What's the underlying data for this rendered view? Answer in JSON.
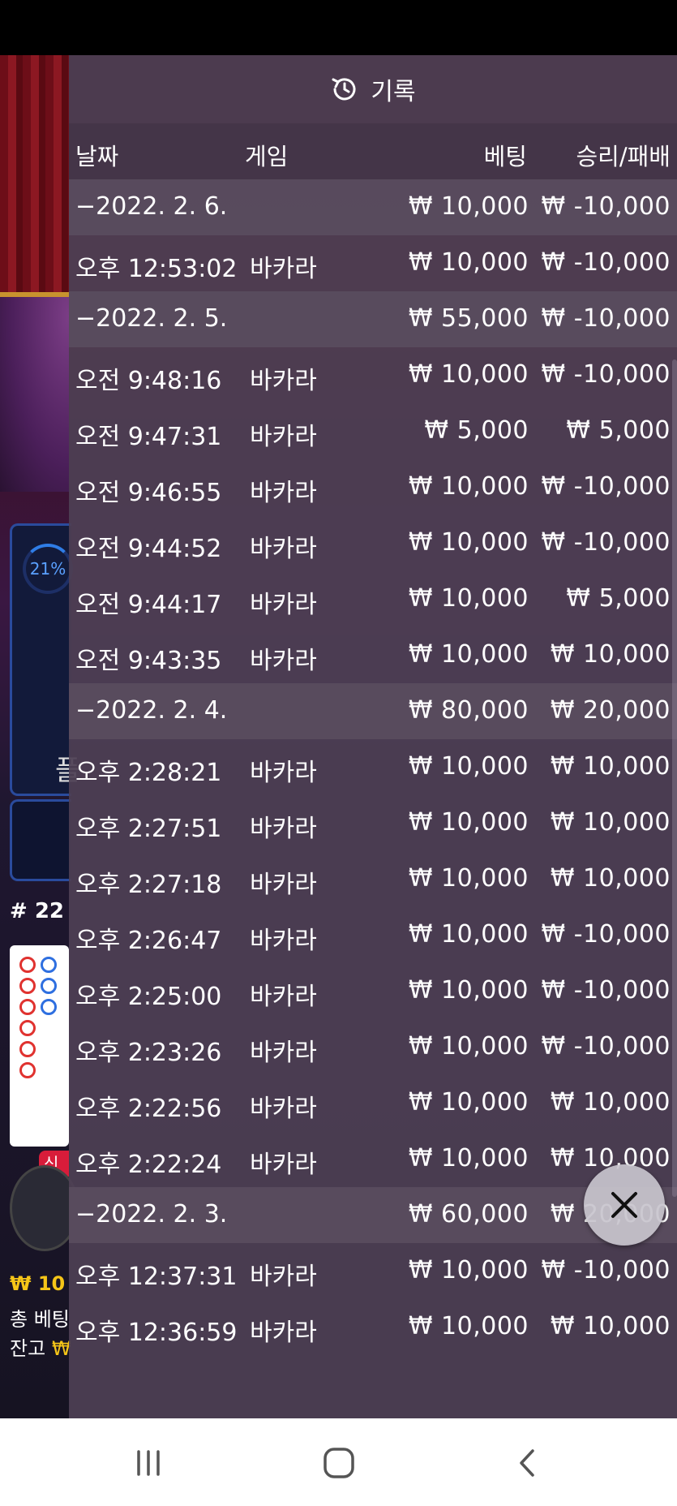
{
  "background": {
    "progress_percent": "21%",
    "side_label": "플",
    "round_number": "# 22",
    "new_badge": "신",
    "balance_line": "₩ 10",
    "total_bet_label": "총 베팅",
    "balance_label": "잔고",
    "balance_value": "₩"
  },
  "panel": {
    "title": "기록",
    "icon": "history-icon",
    "columns": {
      "date": "날짜",
      "game": "게임",
      "bet": "베팅",
      "win_loss": "승리/패배"
    },
    "rows": [
      {
        "type": "group",
        "date": "−2022. 2. 6.",
        "game": "",
        "bet": "₩ 10,000",
        "win": "₩ -10,000"
      },
      {
        "type": "item",
        "date": "오후 12:53:02",
        "game": "바카라",
        "bet": "₩ 10,000",
        "win": "₩ -10,000"
      },
      {
        "type": "group",
        "date": "−2022. 2. 5.",
        "game": "",
        "bet": "₩ 55,000",
        "win": "₩ -10,000"
      },
      {
        "type": "item",
        "date": "오전 9:48:16",
        "game": "바카라",
        "bet": "₩ 10,000",
        "win": "₩ -10,000"
      },
      {
        "type": "item",
        "date": "오전 9:47:31",
        "game": "바카라",
        "bet": "₩ 5,000",
        "win": "₩ 5,000"
      },
      {
        "type": "item",
        "date": "오전 9:46:55",
        "game": "바카라",
        "bet": "₩ 10,000",
        "win": "₩ -10,000"
      },
      {
        "type": "item",
        "date": "오전 9:44:52",
        "game": "바카라",
        "bet": "₩ 10,000",
        "win": "₩ -10,000"
      },
      {
        "type": "item",
        "date": "오전 9:44:17",
        "game": "바카라",
        "bet": "₩ 10,000",
        "win": "₩ 5,000"
      },
      {
        "type": "item",
        "date": "오전 9:43:35",
        "game": "바카라",
        "bet": "₩ 10,000",
        "win": "₩ 10,000"
      },
      {
        "type": "group",
        "date": "−2022. 2. 4.",
        "game": "",
        "bet": "₩ 80,000",
        "win": "₩ 20,000"
      },
      {
        "type": "item",
        "date": "오후 2:28:21",
        "game": "바카라",
        "bet": "₩ 10,000",
        "win": "₩ 10,000"
      },
      {
        "type": "item",
        "date": "오후 2:27:51",
        "game": "바카라",
        "bet": "₩ 10,000",
        "win": "₩ 10,000"
      },
      {
        "type": "item",
        "date": "오후 2:27:18",
        "game": "바카라",
        "bet": "₩ 10,000",
        "win": "₩ 10,000"
      },
      {
        "type": "item",
        "date": "오후 2:26:47",
        "game": "바카라",
        "bet": "₩ 10,000",
        "win": "₩ -10,000"
      },
      {
        "type": "item",
        "date": "오후 2:25:00",
        "game": "바카라",
        "bet": "₩ 10,000",
        "win": "₩ -10,000"
      },
      {
        "type": "item",
        "date": "오후 2:23:26",
        "game": "바카라",
        "bet": "₩ 10,000",
        "win": "₩ -10,000"
      },
      {
        "type": "item",
        "date": "오후 2:22:56",
        "game": "바카라",
        "bet": "₩ 10,000",
        "win": "₩ 10,000"
      },
      {
        "type": "item",
        "date": "오후 2:22:24",
        "game": "바카라",
        "bet": "₩ 10,000",
        "win": "₩ 10,000"
      },
      {
        "type": "group",
        "date": "−2022. 2. 3.",
        "game": "",
        "bet": "₩ 60,000",
        "win": "₩ 20,000"
      },
      {
        "type": "item",
        "date": "오후 12:37:31",
        "game": "바카라",
        "bet": "₩ 10,000",
        "win": "₩ -10,000"
      },
      {
        "type": "item",
        "date": "오후 12:36:59",
        "game": "바카라",
        "bet": "₩ 10,000",
        "win": "₩ 10,000"
      }
    ]
  },
  "close_icon": "close-icon",
  "navbar": {
    "recents": "recents-icon",
    "home": "home-icon",
    "back": "back-icon"
  }
}
